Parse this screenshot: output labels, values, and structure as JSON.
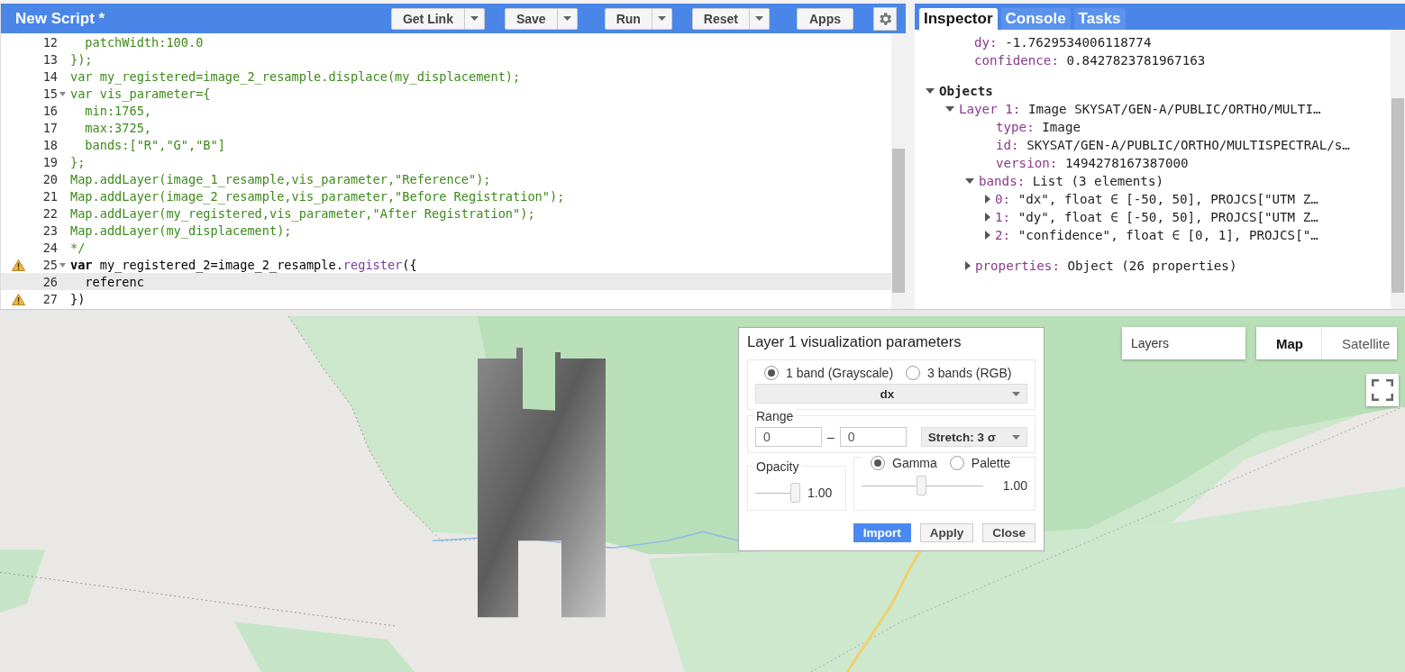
{
  "editor": {
    "title": "New Script *",
    "buttons": [
      {
        "label": "Get Link",
        "dropdown": true
      },
      {
        "label": "Save",
        "dropdown": true
      },
      {
        "label": "Run",
        "dropdown": true
      },
      {
        "label": "Reset",
        "dropdown": true
      },
      {
        "label": "Apps",
        "dropdown": false
      }
    ],
    "lines": [
      {
        "number": "12",
        "foldable": false,
        "warning": false,
        "current": false,
        "tokens": [
          {
            "text": "  patchWidth:100.0",
            "kind": "comment"
          }
        ]
      },
      {
        "number": "13",
        "foldable": false,
        "warning": false,
        "current": false,
        "tokens": [
          {
            "text": "});",
            "kind": "comment"
          }
        ]
      },
      {
        "number": "14",
        "foldable": false,
        "warning": false,
        "current": false,
        "tokens": [
          {
            "text": "var my_registered=image_2_resample.displace(my_displacement);",
            "kind": "comment"
          }
        ]
      },
      {
        "number": "15",
        "foldable": true,
        "warning": false,
        "current": false,
        "tokens": [
          {
            "text": "var vis_parameter={",
            "kind": "comment"
          }
        ]
      },
      {
        "number": "16",
        "foldable": false,
        "warning": false,
        "current": false,
        "tokens": [
          {
            "text": "  min:1765,",
            "kind": "comment"
          }
        ]
      },
      {
        "number": "17",
        "foldable": false,
        "warning": false,
        "current": false,
        "tokens": [
          {
            "text": "  max:3725,",
            "kind": "comment"
          }
        ]
      },
      {
        "number": "18",
        "foldable": false,
        "warning": false,
        "current": false,
        "tokens": [
          {
            "text": "  bands:[\"R\",\"G\",\"B\"]",
            "kind": "comment"
          }
        ]
      },
      {
        "number": "19",
        "foldable": false,
        "warning": false,
        "current": false,
        "tokens": [
          {
            "text": "};",
            "kind": "comment"
          }
        ]
      },
      {
        "number": "20",
        "foldable": false,
        "warning": false,
        "current": false,
        "tokens": [
          {
            "text": "Map.addLayer(image_1_resample,vis_parameter,\"Reference\");",
            "kind": "comment"
          }
        ]
      },
      {
        "number": "21",
        "foldable": false,
        "warning": false,
        "current": false,
        "tokens": [
          {
            "text": "Map.addLayer(image_2_resample,vis_parameter,\"Before Registration\");",
            "kind": "comment"
          }
        ]
      },
      {
        "number": "22",
        "foldable": false,
        "warning": false,
        "current": false,
        "tokens": [
          {
            "text": "Map.addLayer(my_registered,vis_parameter,\"After Registration\");",
            "kind": "comment"
          }
        ]
      },
      {
        "number": "23",
        "foldable": false,
        "warning": false,
        "current": false,
        "tokens": [
          {
            "text": "Map.addLayer(my_displacement);",
            "kind": "comment"
          }
        ]
      },
      {
        "number": "24",
        "foldable": false,
        "warning": false,
        "current": false,
        "tokens": [
          {
            "text": "*/",
            "kind": "comment"
          }
        ]
      },
      {
        "number": "25",
        "foldable": true,
        "warning": true,
        "current": false,
        "tokens": [
          {
            "text": "var",
            "kind": "keyword"
          },
          {
            "text": " my_registered_2=image_2_resample.",
            "kind": "plain"
          },
          {
            "text": "register",
            "kind": "method"
          },
          {
            "text": "({",
            "kind": "plain"
          }
        ]
      },
      {
        "number": "26",
        "foldable": false,
        "warning": false,
        "current": true,
        "tokens": [
          {
            "text": "  referenc",
            "kind": "plain"
          }
        ]
      },
      {
        "number": "27",
        "foldable": false,
        "warning": true,
        "current": false,
        "tokens": [
          {
            "text": "})",
            "kind": "plain"
          }
        ]
      }
    ]
  },
  "inspector": {
    "tabs": [
      {
        "label": "Inspector",
        "selected": true
      },
      {
        "label": "Console",
        "selected": false
      },
      {
        "label": "Tasks",
        "selected": false
      }
    ],
    "tree": [
      {
        "kind": "leaf",
        "key": "dy:",
        "value": "-1.7629534006118774"
      },
      {
        "kind": "leaf",
        "key": "confidence:",
        "value": "0.8427823781967163"
      },
      {
        "kind": "section",
        "key": "Objects",
        "expanded": true,
        "children": [
          {
            "kind": "branch",
            "key": "Layer 1:",
            "value": "Image SKYSAT/GEN-A/PUBLIC/ORTHO/MULTI…",
            "expanded": true,
            "children": [
              {
                "kind": "leaf",
                "key": "type:",
                "value": "Image"
              },
              {
                "kind": "leaf",
                "key": "id:",
                "value": "SKYSAT/GEN-A/PUBLIC/ORTHO/MULTISPECTRAL/s…"
              },
              {
                "kind": "leaf",
                "key": "version:",
                "value": "1494278167387000"
              },
              {
                "kind": "branch",
                "key": "bands:",
                "value": "List (3 elements)",
                "expanded": true,
                "children": [
                  {
                    "kind": "branch",
                    "key": "0:",
                    "value": "\"dx\", float ∈ [-50, 50], PROJCS[\"UTM Z…",
                    "expanded": false
                  },
                  {
                    "kind": "branch",
                    "key": "1:",
                    "value": "\"dy\", float ∈ [-50, 50], PROJCS[\"UTM Z…",
                    "expanded": false
                  },
                  {
                    "kind": "branch",
                    "key": "2:",
                    "value": "\"confidence\", float ∈ [0, 1], PROJCS[\"…",
                    "expanded": false
                  }
                ]
              },
              {
                "kind": "branch",
                "key": "properties:",
                "value": "Object (26 properties)",
                "expanded": false
              }
            ]
          }
        ]
      }
    ]
  },
  "map": {
    "layers_button": "Layers",
    "map_types": [
      {
        "label": "Map",
        "selected": true
      },
      {
        "label": "Satellite",
        "selected": false
      }
    ],
    "dialog": {
      "title": "Layer 1 visualization parameters",
      "band_modes": [
        {
          "label": "1 band (Grayscale)",
          "selected": true
        },
        {
          "label": "3 bands (RGB)",
          "selected": false
        }
      ],
      "band": "dx",
      "range_label": "Range",
      "range_min": "0",
      "range_separator": "–",
      "range_max": "0",
      "stretch": "Stretch: 3 σ",
      "opacity_label": "Opacity",
      "opacity_slider": {
        "level": 1
      },
      "opacity_reading": "1.00",
      "modes": [
        {
          "label": "Gamma",
          "selected": true
        },
        {
          "label": "Palette",
          "selected": false
        }
      ],
      "gamma_slider": {
        "level": 0.5
      },
      "gamma_reading": "1.00",
      "buttons": [
        {
          "label": "Import",
          "primary": true
        },
        {
          "label": "Apply",
          "primary": false
        },
        {
          "label": "Close",
          "primary": false
        }
      ]
    }
  }
}
